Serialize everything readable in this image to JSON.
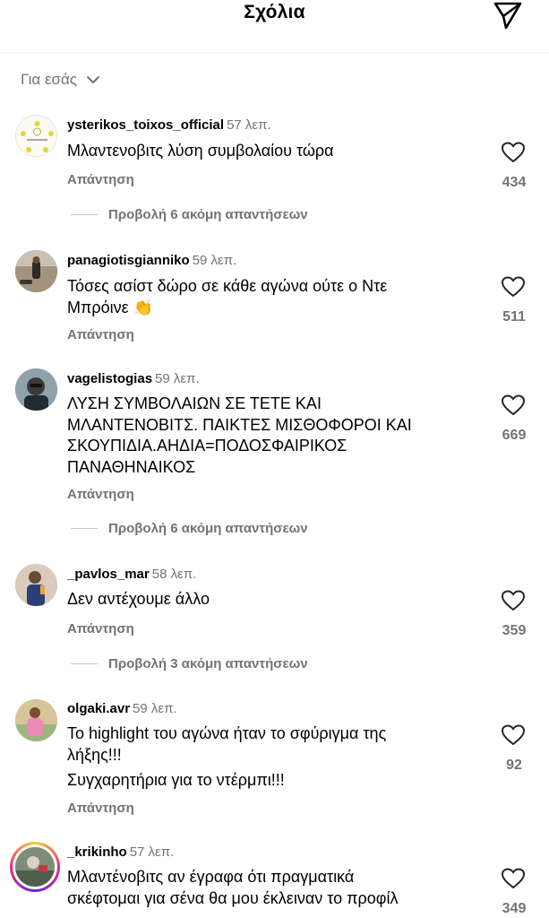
{
  "header": {
    "title": "Σχόλια",
    "send_icon": "send-icon"
  },
  "filter": {
    "label": "Για εσάς",
    "icon": "chevron-down-icon"
  },
  "comments": [
    {
      "username": "ysterikos_toixos_official",
      "time": "57 λεπ.",
      "lines": [
        "Μλαντενοβιτς λύση συμβολαίου τώρα"
      ],
      "reply_label": "Απάντηση",
      "likes": "434",
      "more_replies": "Προβολή 6 ακόμη απαντήσεων"
    },
    {
      "username": "panagiotisgianniko",
      "time": "59 λεπ.",
      "lines": [
        "Τόσες ασίστ δώρο σε κάθε αγώνα ούτε ο Ντε",
        "Μπρόινε 👏"
      ],
      "reply_label": "Απάντηση",
      "likes": "511"
    },
    {
      "username": "vagelistogias",
      "time": "59 λεπ.",
      "lines": [
        "ΛΥΣΗ ΣΥΜΒΟΛΑΙΩΝ ΣΕ ΤΕΤΕ ΚΑΙ",
        "ΜΛΑΝΤΕΝΟΒΙΤΣ. ΠΑΙΚΤΕΣ ΜΙΣΘΟΦΟΡΟΙ ΚΑΙ",
        "ΣΚΟΥΠΙΔΙΑ.ΑΗΔΙΑ=ΠΟΔΟΣΦΑΙΡΙΚΟΣ",
        "ΠΑΝΑΘΗΝΑΙΚΟΣ"
      ],
      "reply_label": "Απάντηση",
      "likes": "669",
      "more_replies": "Προβολή 6 ακόμη απαντήσεων"
    },
    {
      "username": "_pavlos_mar",
      "time": "58 λεπ.",
      "lines": [
        "Δεν αντέχουμε άλλο"
      ],
      "reply_label": "Απάντηση",
      "likes": "359",
      "more_replies": "Προβολή 3 ακόμη απαντήσεων"
    },
    {
      "username": "olgaki.avr",
      "time": "59 λεπ.",
      "lines": [
        "Το highlight του αγώνα ήταν το σφύριγμα της",
        "λήξης!!!",
        "Συγχαρητήρια για το ντέρμπι!!!"
      ],
      "reply_label": "Απάντηση",
      "likes": "92"
    },
    {
      "username": "_krikinho",
      "time": "57 λεπ.",
      "lines": [
        "Μλαντένοβιτς αν έγραφα ότι πραγματικά",
        "σκέφτομαι για σένα θα μου έκλειναν το προφίλ"
      ],
      "likes": "349"
    }
  ],
  "colors": {
    "text": "#000000",
    "secondary": "#737373",
    "divider": "#efefef",
    "story_ring": "#ee2a7b"
  }
}
